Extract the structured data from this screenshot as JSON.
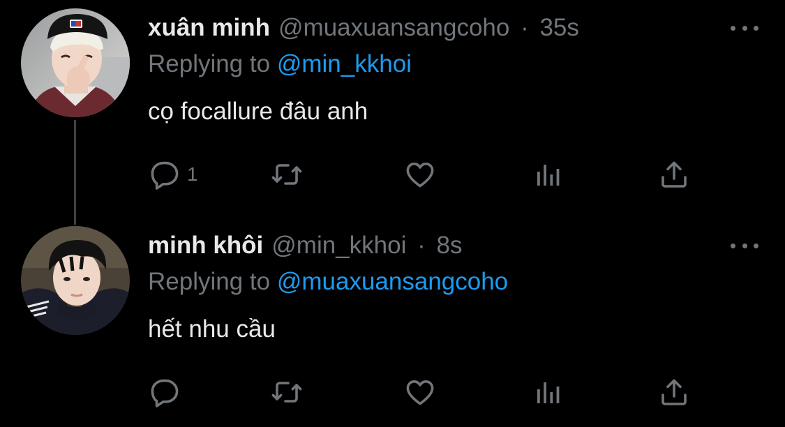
{
  "thread_line_color": "#3d4247",
  "colors": {
    "background": "#000000",
    "text": "#e7e9ea",
    "secondary": "#71767b",
    "link": "#1d9bf0"
  },
  "tweets": [
    {
      "display_name": "xuân minh",
      "handle": "@muaxuansangcoho",
      "separator": "·",
      "time": "35s",
      "replying_prefix": "Replying to",
      "replying_to": "@min_kkhoi",
      "text": "cọ focallure đâu anh",
      "reply_count": "1",
      "avatar": "avatar-photo"
    },
    {
      "display_name": "minh khôi",
      "handle": "@min_kkhoi",
      "separator": "·",
      "time": "8s",
      "replying_prefix": "Replying to",
      "replying_to": "@muaxuansangcoho",
      "text": "hết nhu cầu",
      "reply_count": "",
      "avatar": "avatar-photo"
    }
  ],
  "icons": {
    "reply": "reply-icon",
    "retweet": "retweet-icon",
    "like": "heart-icon",
    "analytics": "analytics-icon",
    "share": "share-icon",
    "more": "more-icon"
  }
}
